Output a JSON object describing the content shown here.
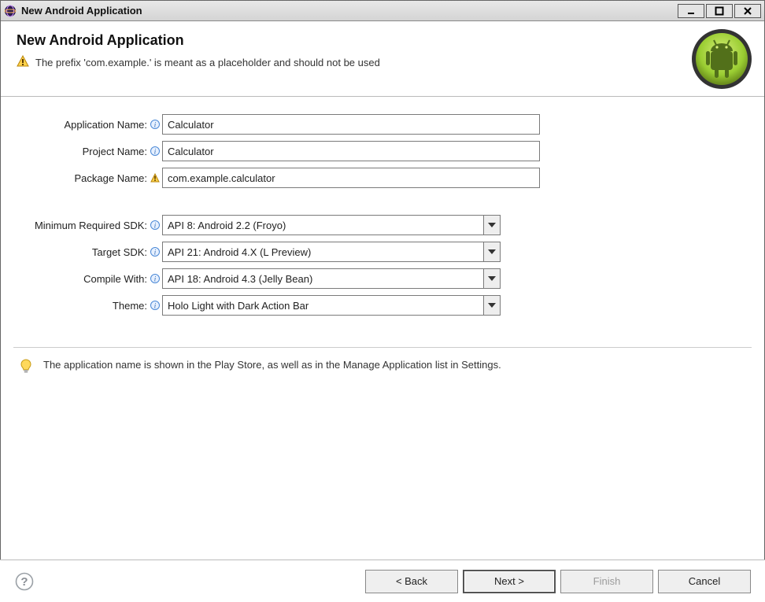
{
  "window": {
    "title": "New Android Application"
  },
  "banner": {
    "heading": "New Android Application",
    "warning": "The prefix 'com.example.' is meant as a placeholder and should not be used"
  },
  "form": {
    "appName": {
      "label": "Application Name:",
      "value": "Calculator"
    },
    "projectName": {
      "label": "Project Name:",
      "value": "Calculator"
    },
    "packageName": {
      "label": "Package Name:",
      "value": "com.example.calculator"
    },
    "minSdk": {
      "label": "Minimum Required SDK:",
      "value": "API 8: Android 2.2 (Froyo)"
    },
    "targetSdk": {
      "label": "Target SDK:",
      "value": "API 21: Android 4.X (L Preview)"
    },
    "compileWith": {
      "label": "Compile With:",
      "value": "API 18: Android 4.3 (Jelly Bean)"
    },
    "theme": {
      "label": "Theme:",
      "value": "Holo Light with Dark Action Bar"
    }
  },
  "tip": "The application name is shown in the Play Store, as well as in the Manage Application list in Settings.",
  "footer": {
    "back": "< Back",
    "next": "Next >",
    "finish": "Finish",
    "cancel": "Cancel"
  }
}
